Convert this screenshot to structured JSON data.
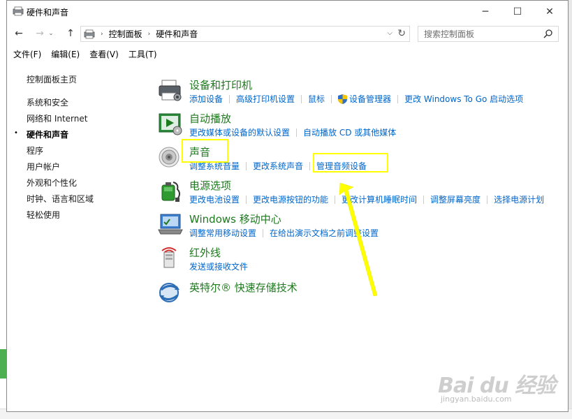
{
  "window": {
    "title": "硬件和声音",
    "controls": {
      "minimize": "─",
      "maximize": "☐",
      "close": "✕"
    }
  },
  "nav": {
    "back": "←",
    "forward": "→",
    "recent": "⌄",
    "up": "↑",
    "breadcrumbs": [
      "控制面板",
      "硬件和声音"
    ],
    "separator": "›",
    "dropdown": "⌵",
    "refresh": "↻",
    "search_placeholder": "搜索控制面板"
  },
  "menu": [
    "文件(F)",
    "编辑(E)",
    "查看(V)",
    "工具(T)"
  ],
  "sidebar": {
    "items": [
      {
        "label": "控制面板主页",
        "current": false
      },
      {
        "label": "系统和安全",
        "current": false
      },
      {
        "label": "网络和 Internet",
        "current": false
      },
      {
        "label": "硬件和声音",
        "current": true
      },
      {
        "label": "程序",
        "current": false
      },
      {
        "label": "用户帐户",
        "current": false
      },
      {
        "label": "外观和个性化",
        "current": false
      },
      {
        "label": "时钟、语言和区域",
        "current": false
      },
      {
        "label": "轻松使用",
        "current": false
      }
    ],
    "bullet": "•"
  },
  "categories": [
    {
      "title": "设备和打印机",
      "icon": "printer-icon",
      "links": [
        "添加设备",
        "高级打印机设置",
        "鼠标",
        "设备管理器",
        "更改 Windows To Go 启动选项"
      ]
    },
    {
      "title": "自动播放",
      "icon": "autoplay-icon",
      "links": [
        "更改媒体或设备的默认设置",
        "自动播放 CD 或其他媒体"
      ]
    },
    {
      "title": "声音",
      "icon": "speaker-icon",
      "links": [
        "调整系统音量",
        "更改系统声音",
        "管理音频设备"
      ]
    },
    {
      "title": "电源选项",
      "icon": "battery-icon",
      "links": [
        "更改电池设置",
        "更改电源按钮的功能",
        "更改计算机睡眠时间",
        "调整屏幕亮度",
        "选择电源计划"
      ]
    },
    {
      "title": "Windows 移动中心",
      "icon": "mobility-center-icon",
      "links": [
        "调整常用移动设置",
        "在给出演示文档之前调整设置"
      ]
    },
    {
      "title": "红外线",
      "icon": "infrared-icon",
      "links": [
        "发送或接收文件"
      ]
    },
    {
      "title": "英特尔® 快速存储技术",
      "icon": "intel-rst-icon",
      "links": []
    }
  ],
  "colors": {
    "category_title": "#1e7a1e",
    "link": "#0066cc",
    "annotation": "#ffff00"
  },
  "watermark": {
    "main": "Bai du 经验",
    "sub": "jingyan.baidu.com"
  }
}
